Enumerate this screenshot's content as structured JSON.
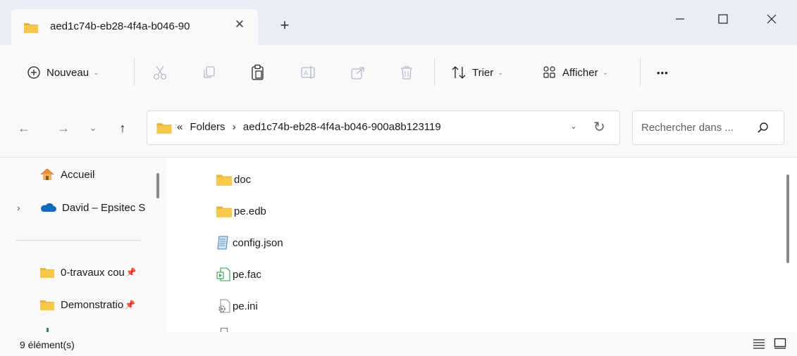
{
  "tab": {
    "title": "aed1c74b-eb28-4f4a-b046-90"
  },
  "toolbar": {
    "new_label": "Nouveau",
    "sort_label": "Trier",
    "view_label": "Afficher",
    "more_label": "•••"
  },
  "address": {
    "overflow": "«",
    "crumbs": [
      "Folders",
      "aed1c74b-eb28-4f4a-b046-900a8b123119"
    ],
    "separator": "›"
  },
  "search": {
    "placeholder": "Rechercher dans ..."
  },
  "sidebar": {
    "items": [
      {
        "label": "Accueil",
        "icon": "home-icon"
      },
      {
        "label": "David – Epsitec S",
        "icon": "cloud-icon"
      },
      {
        "label": "0-travaux cou",
        "icon": "folder-icon",
        "pinned": true
      },
      {
        "label": "Demonstratio",
        "icon": "folder-icon",
        "pinned": true
      }
    ]
  },
  "files": [
    {
      "name": "doc",
      "type": "folder"
    },
    {
      "name": "pe.edb",
      "type": "folder"
    },
    {
      "name": "config.json",
      "type": "json"
    },
    {
      "name": "pe.fac",
      "type": "fac"
    },
    {
      "name": "pe.ini",
      "type": "ini"
    }
  ],
  "status": {
    "count": "9 élément(s)"
  },
  "colors": {
    "folder": "#f7c94a",
    "folder_dark": "#e8b33a",
    "cloud": "#0f6cbd",
    "home": "#e8903a",
    "titlebar": "#e9eef6"
  }
}
